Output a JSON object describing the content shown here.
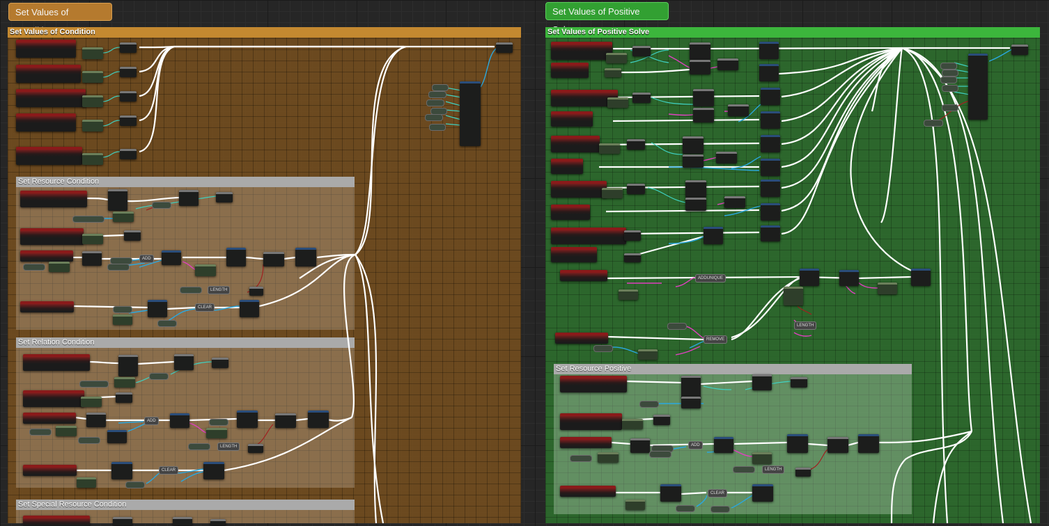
{
  "bubbles": {
    "condition": "Set Values of Condition",
    "positive": "Set Values of Positive Solve"
  },
  "comments": {
    "condition": "Set Values of Condition",
    "positive": "Set Values of Positive Solve",
    "resource_condition": "Set Resource Condition",
    "relation_condition": "Set Relation Condition",
    "special_resource_condition": "Set Special Resource Condition",
    "resource_positive": "Set Resource Positive"
  },
  "node_tags": {
    "add": "ADD",
    "length": "LENGTH",
    "clear": "CLEAR",
    "addunique": "ADDUNIQUE",
    "remove": "REMOVE"
  },
  "colors": {
    "condition_header": "#c48930",
    "positive_header": "#3cb63c",
    "exec_wire": "#ffffff",
    "data_wire_teal": "#3fd0c0",
    "data_wire_blue": "#2aa8e0",
    "data_wire_magenta": "#e040c0",
    "data_wire_red": "#a02020"
  }
}
